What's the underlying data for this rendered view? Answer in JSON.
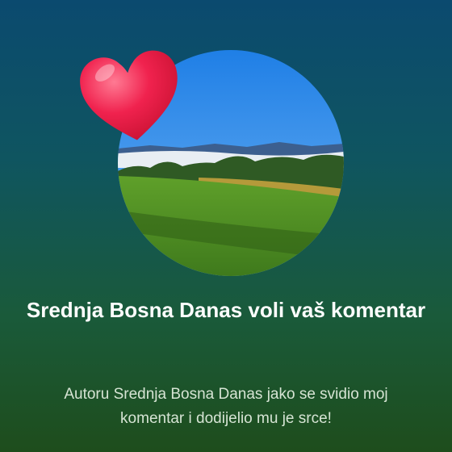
{
  "notification": {
    "title": "Srednja Bosna Danas voli vaš komentar",
    "message": "Autoru Srednja Bosna Danas jako se svidio moj komentar i dodijelio mu je srce!"
  },
  "icons": {
    "reaction": "heart-icon",
    "image": "page-photo"
  },
  "colors": {
    "heart": "#f0224e",
    "title": "#ffffff",
    "message": "#d6e4d4"
  }
}
